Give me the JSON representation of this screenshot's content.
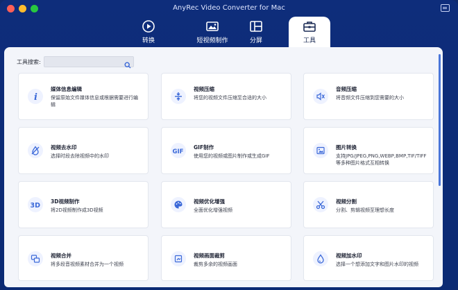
{
  "window": {
    "title": "AnyRec Video Converter for Mac"
  },
  "tabs": [
    {
      "label": "转换",
      "icon": "convert-icon"
    },
    {
      "label": "短视频制作",
      "icon": "short-video-icon"
    },
    {
      "label": "分屏",
      "icon": "split-screen-icon"
    },
    {
      "label": "工具",
      "icon": "toolbox-icon"
    }
  ],
  "search": {
    "label": "工具搜索:",
    "value": "",
    "placeholder": ""
  },
  "tools": [
    {
      "title": "媒体信息编辑",
      "desc": "保留原始文件媒体信息或根据需要进行编辑",
      "icon": "info-icon"
    },
    {
      "title": "视频压缩",
      "desc": "将您的视频文件压缩至合适的大小",
      "icon": "video-compress-icon"
    },
    {
      "title": "音频压缩",
      "desc": "将音频文件压缩到您需要的大小",
      "icon": "audio-compress-icon"
    },
    {
      "title": "视频去水印",
      "desc": "选择时段去除视频中的水印",
      "icon": "watermark-remove-icon"
    },
    {
      "title": "GIF制作",
      "desc": "使用您的视频或图片制作或生成GIF",
      "icon": "gif-icon"
    },
    {
      "title": "图片转换",
      "desc": "支持JPG/JPEG,PNG,WEBP,BMP,TIF/TIFF等多种图片格式互相转换",
      "icon": "image-convert-icon"
    },
    {
      "title": "3D视频制作",
      "desc": "将2D视频制作成3D视频",
      "icon": "3d-icon"
    },
    {
      "title": "视频优化增强",
      "desc": "全面优化增强视频",
      "icon": "palette-icon"
    },
    {
      "title": "视频分割",
      "desc": "分割、剪辑视频至理想长度",
      "icon": "scissors-icon"
    },
    {
      "title": "视频合并",
      "desc": "将多段音视频素材合并为一个视频",
      "icon": "merge-icon"
    },
    {
      "title": "视频画面裁剪",
      "desc": "裁剪多余的视频画面",
      "icon": "crop-icon"
    },
    {
      "title": "视频加水印",
      "desc": "选择一个想添加文字和图片水印的视频",
      "icon": "watermark-add-icon"
    }
  ],
  "colors": {
    "accent": "#3a68d8",
    "titlebar": "#0e2d7b",
    "content_bg": "#f3f5fa"
  }
}
